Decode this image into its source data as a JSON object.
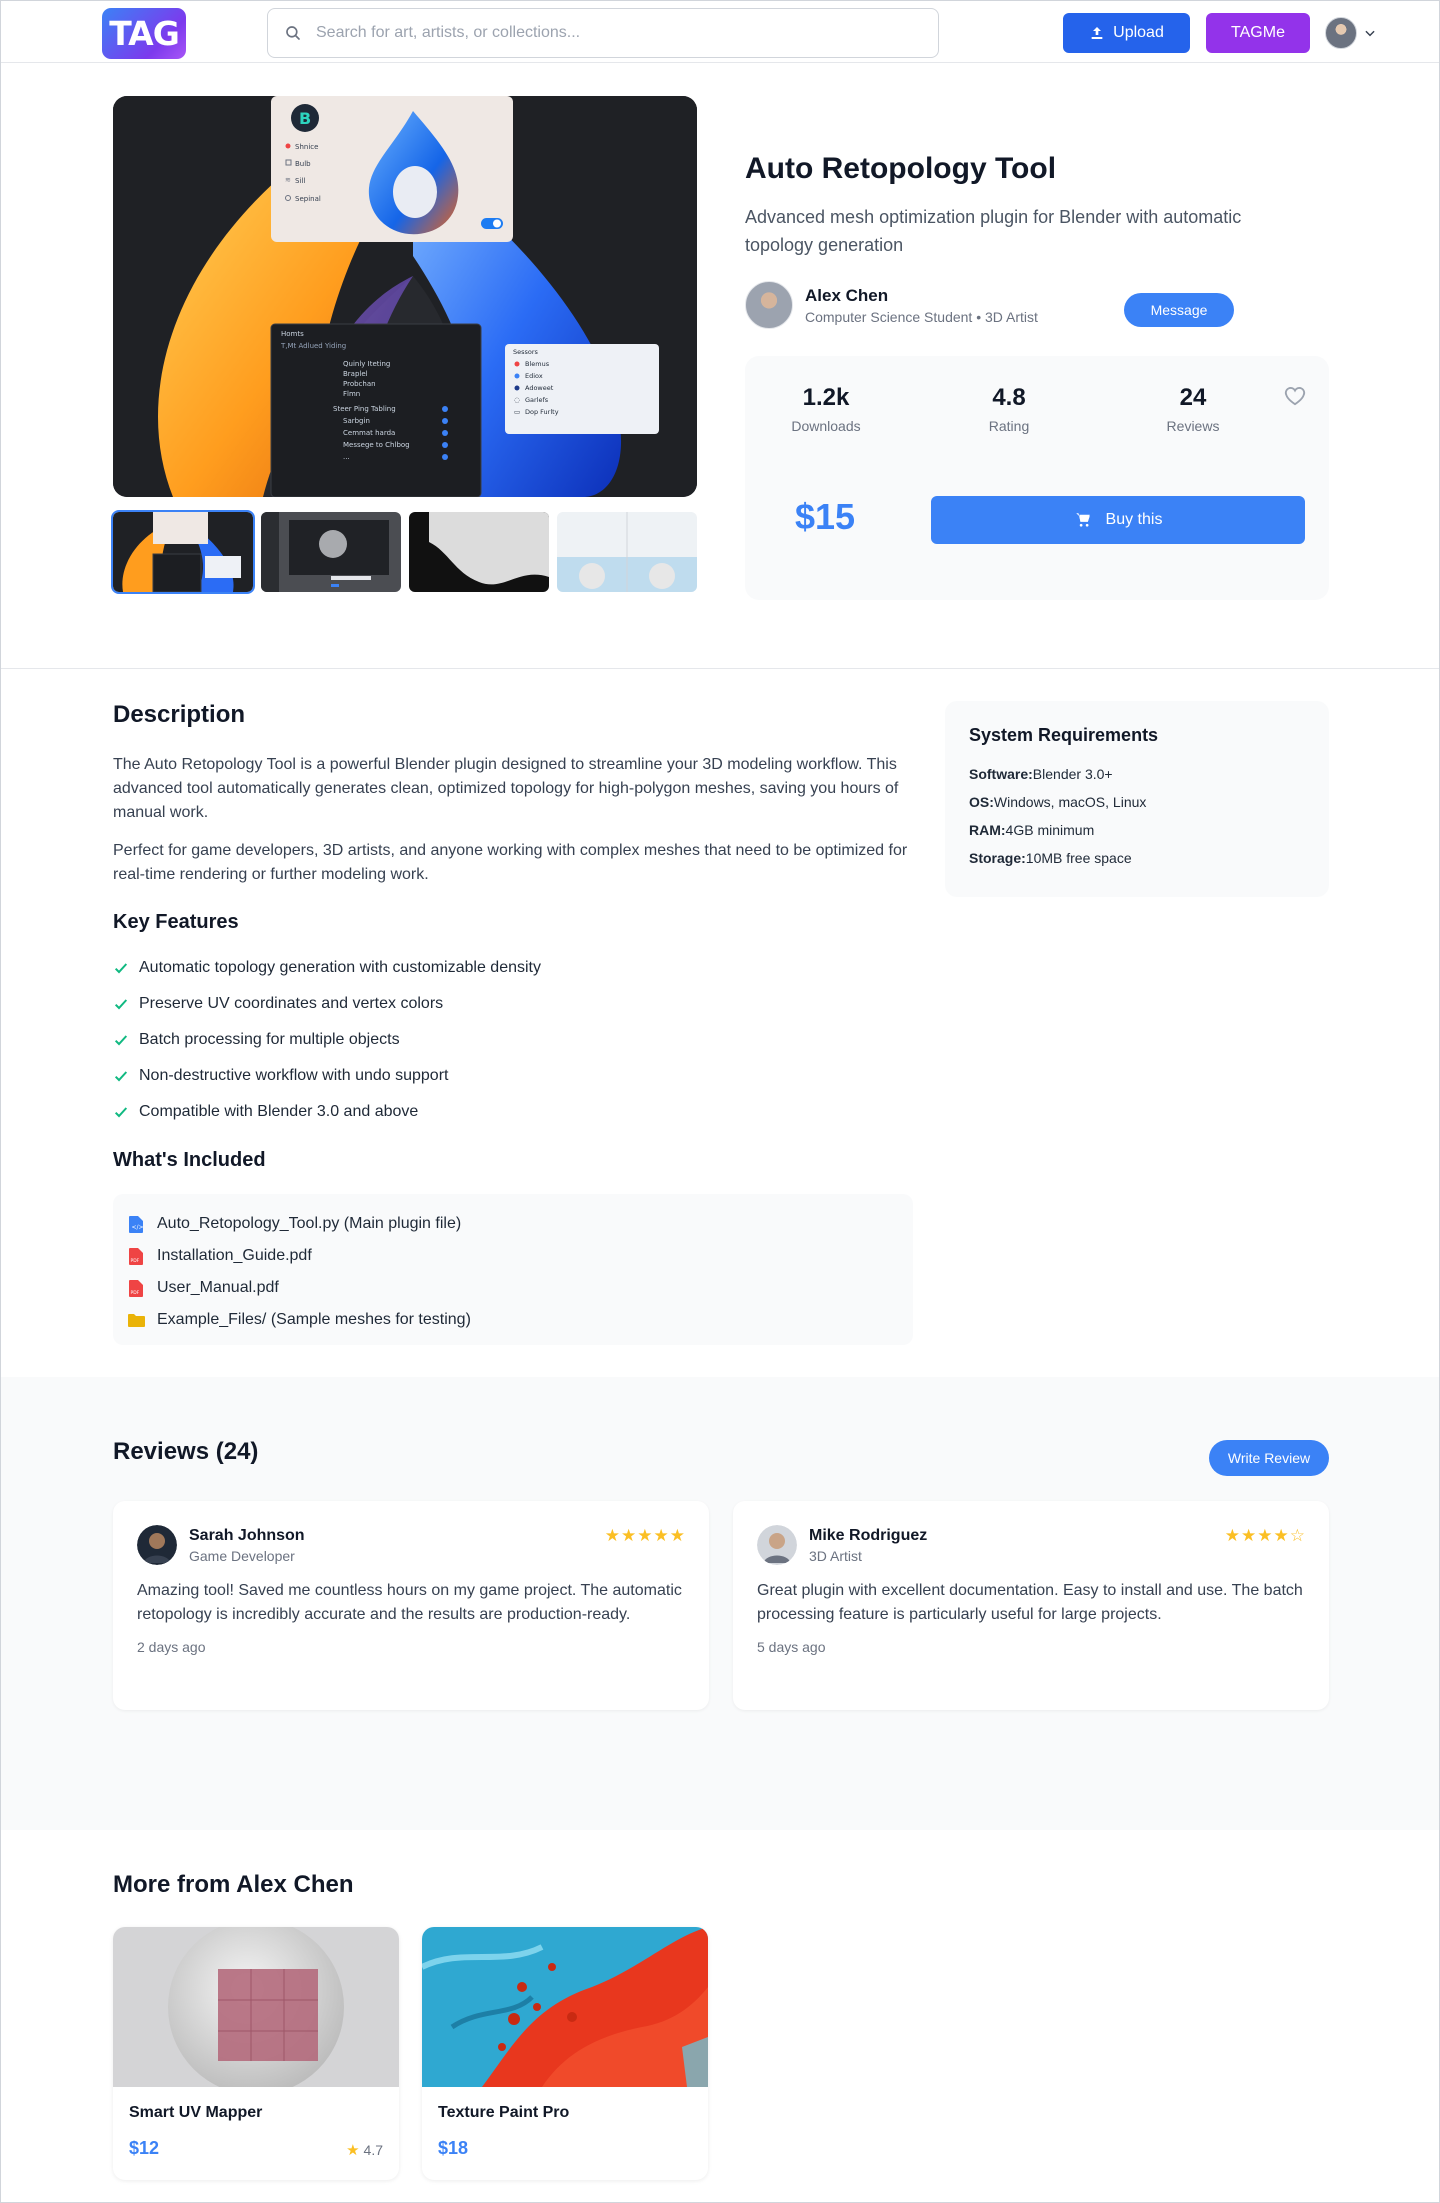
{
  "header": {
    "logo": "TAG",
    "search_placeholder": "Search for art, artists, or collections...",
    "upload_label": "Upload",
    "tagme_label": "TAGMe"
  },
  "product": {
    "title": "Auto Retopology Tool",
    "subtitle": "Advanced mesh optimization plugin for Blender with automatic topology generation",
    "seller_name": "Alex Chen",
    "seller_role": "Computer Science Student • 3D Artist",
    "message_label": "Message",
    "stats": [
      {
        "value": "1.2k",
        "label": "Downloads"
      },
      {
        "value": "4.8",
        "label": "Rating"
      },
      {
        "value": "24",
        "label": "Reviews"
      }
    ],
    "price": "$15",
    "buy_label": "Buy this"
  },
  "description": {
    "title": "Description",
    "paragraphs": [
      "The Auto Retopology Tool is a powerful Blender plugin designed to streamline your 3D modeling workflow. This advanced tool automatically generates clean, optimized topology for high-polygon meshes, saving you hours of manual work.",
      "Perfect for game developers, 3D artists, and anyone working with complex meshes that need to be optimized for real-time rendering or further modeling work."
    ],
    "features_title": "Key Features",
    "features": [
      "Automatic topology generation with customizable density",
      "Preserve UV coordinates and vertex colors",
      "Batch processing for multiple objects",
      "Non-destructive workflow with undo support",
      "Compatible with Blender 3.0 and above"
    ],
    "included_title": "What's Included",
    "included": [
      {
        "name": "Auto_Retopology_Tool.py (Main plugin file)",
        "icon": "python-file-icon"
      },
      {
        "name": "Installation_Guide.pdf",
        "icon": "pdf-icon"
      },
      {
        "name": "User_Manual.pdf",
        "icon": "pdf-icon"
      },
      {
        "name": "Example_Files/ (Sample meshes for testing)",
        "icon": "folder-icon"
      }
    ]
  },
  "requirements": {
    "title": "System Requirements",
    "rows": [
      {
        "key": "Software:",
        "value": "Blender 3.0+"
      },
      {
        "key": "OS:",
        "value": "Windows, macOS, Linux"
      },
      {
        "key": "RAM:",
        "value": "4GB minimum"
      },
      {
        "key": "Storage:",
        "value": "10MB free space"
      }
    ]
  },
  "reviews": {
    "title": "Reviews (24)",
    "write_label": "Write Review",
    "items": [
      {
        "name": "Sarah Johnson",
        "role": "Game Developer",
        "stars": 5,
        "text": "Amazing tool! Saved me countless hours on my game project. The automatic retopology is incredibly accurate and the results are production-ready.",
        "date": "2 days ago"
      },
      {
        "name": "Mike Rodriguez",
        "role": "3D Artist",
        "stars": 4,
        "text": "Great plugin with excellent documentation. Easy to install and use. The batch processing feature is particularly useful for large projects.",
        "date": "5 days ago"
      }
    ]
  },
  "more": {
    "title": "More from Alex Chen",
    "products": [
      {
        "name": "Smart UV Mapper",
        "price": "$12",
        "rating": "4.7"
      },
      {
        "name": "Texture Paint Pro",
        "price": "$18",
        "rating": ""
      }
    ]
  },
  "mock_ui": {
    "app_letter": "B",
    "menu": [
      "Shnice",
      "Bulb",
      "Sill",
      "Sepinal"
    ],
    "panel_title": "Homts",
    "panel_sub": "T,Mt Adlued Yiding",
    "tree": [
      "Quinly Iteting",
      "Braplel",
      "Probchan",
      "Flmn",
      "Steer Ping Tabling",
      "Sarbgin",
      "Cemmat harda",
      "Messege to Chlbog",
      "..."
    ],
    "side_title": "Sessors",
    "side_items": [
      "Blemus",
      "Ediox",
      "Adoweet",
      "Garlefs",
      "Dop Furlty"
    ]
  },
  "colors": {
    "primary": "#3b82f6",
    "upload": "#2563eb",
    "tagme": "#9333ea",
    "star": "#fbbf24",
    "check": "#10b981"
  }
}
